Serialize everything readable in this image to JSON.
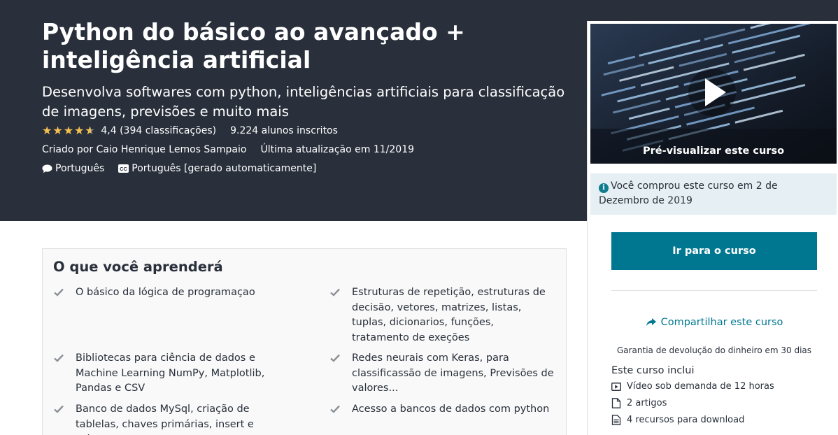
{
  "hero": {
    "title": "Python do básico ao avançado + inteligência artificial",
    "subtitle": "Desenvolva softwares com python, inteligências artificiais para classificação de imagens, previsões e muito mais",
    "rating": "4,4",
    "rating_count": "(394 classificações)",
    "students": "9.224 alunos inscritos",
    "created_by": "Criado por Caio Henrique Lemos Sampaio",
    "last_update": "Última atualização em 11/2019",
    "language": "Português",
    "captions": "Português [gerado automaticamente]",
    "star_color": "#f4c150",
    "background_color": "#29303b"
  },
  "learn": {
    "title": "O que você aprenderá",
    "items": [
      "O básico da lógica de programaçao",
      "Estruturas de repetição, estruturas de decisão, vetores, matrizes, listas, tuplas, dicionarios, funções, tratamento de exeções",
      "Bibliotecas para ciência de dados e Machine Learning NumPy, Matplotlib, Pandas e CSV",
      "Redes neurais com Keras, para classificassão de imagens, Previsões de valores...",
      "Banco de dados MySql, criação de tablelas, chaves primárias, insert e select",
      "Acesso a bancos de dados com python"
    ]
  },
  "sidebar": {
    "preview_label": "Pré-visualizar este curso",
    "purchased_notice": "Você comprou este curso em 2 de Dezembro de 2019",
    "go_button": "Ir para o curso",
    "share_label": "Compartilhar este curso",
    "guarantee": "Garantia de devolução do dinheiro em 30 dias",
    "includes_title": "Este curso inclui",
    "includes": [
      {
        "icon": "video-icon",
        "label": "Vídeo sob demanda de 12 horas"
      },
      {
        "icon": "file-icon",
        "label": "2 artigos"
      },
      {
        "icon": "download-file-icon",
        "label": "4 recursos para download"
      }
    ],
    "accent_color": "#007791",
    "notice_background": "#e6eff3"
  }
}
